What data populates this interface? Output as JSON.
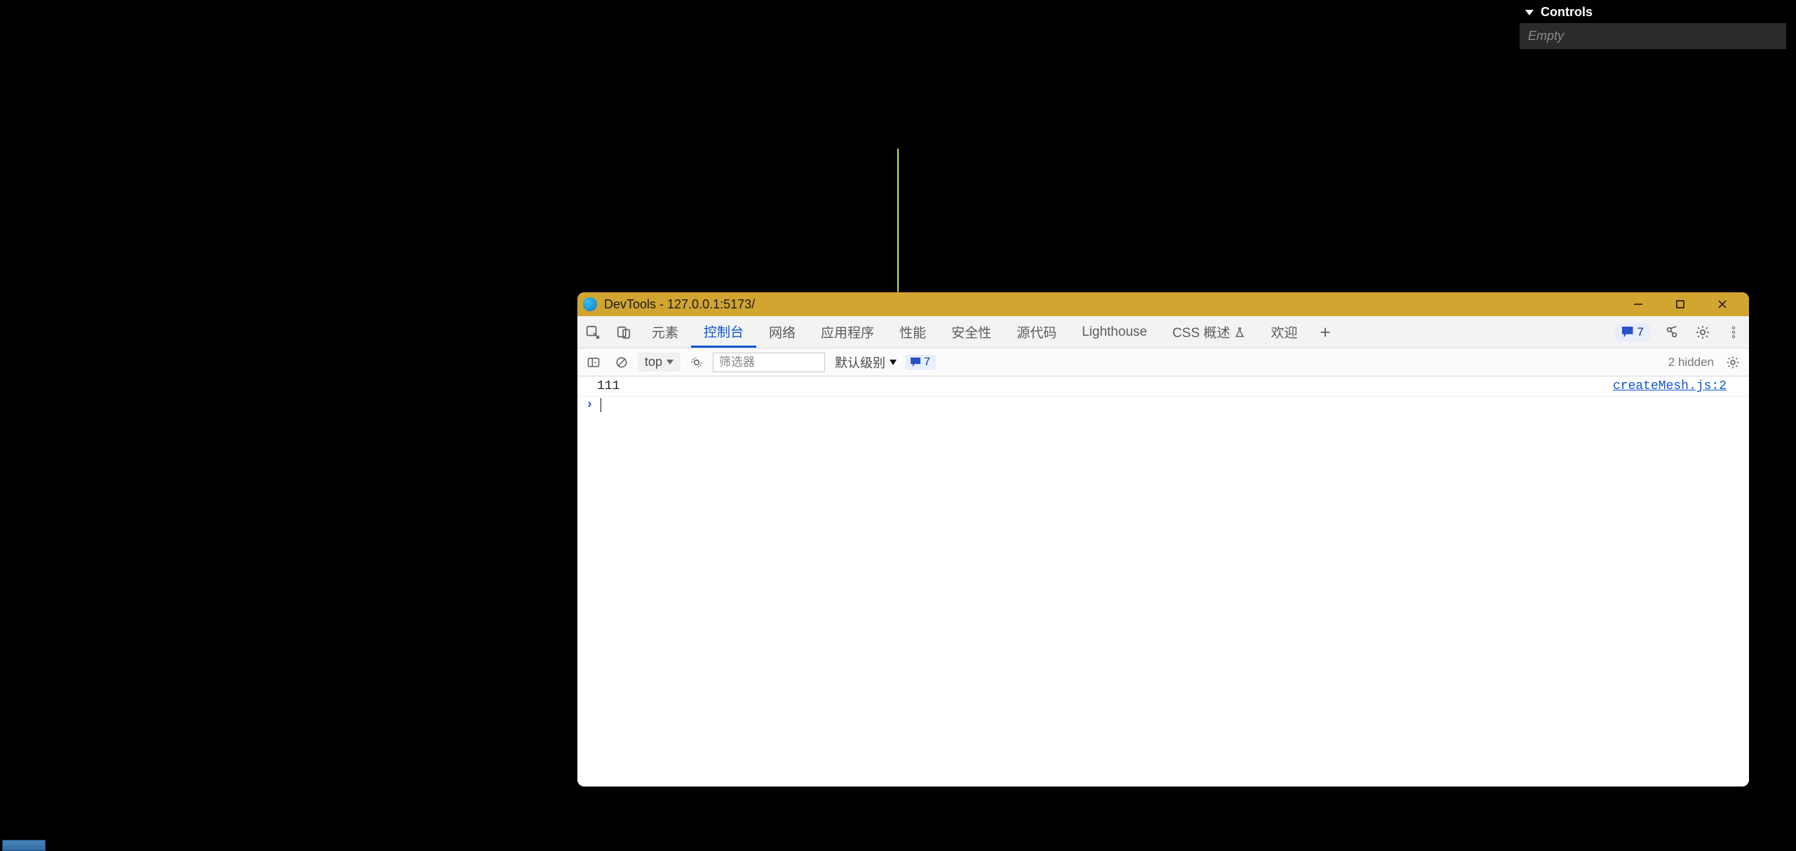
{
  "controls": {
    "title": "Controls",
    "empty": "Empty"
  },
  "devtools": {
    "title": "DevTools - 127.0.0.1:5173/",
    "tabs": {
      "elements": "元素",
      "console": "控制台",
      "network": "网络",
      "application": "应用程序",
      "performance": "性能",
      "security": "安全性",
      "sources": "源代码",
      "lighthouse": "Lighthouse",
      "css_overview": "CSS 概述",
      "welcome": "欢迎"
    },
    "issues": {
      "count": "7"
    },
    "consolebar": {
      "context": "top",
      "filter_placeholder": "筛选器",
      "level": "默认级别",
      "issues_count": "7",
      "hidden": "2 hidden"
    },
    "log": {
      "message": "111",
      "source": "createMesh.js:2"
    }
  }
}
